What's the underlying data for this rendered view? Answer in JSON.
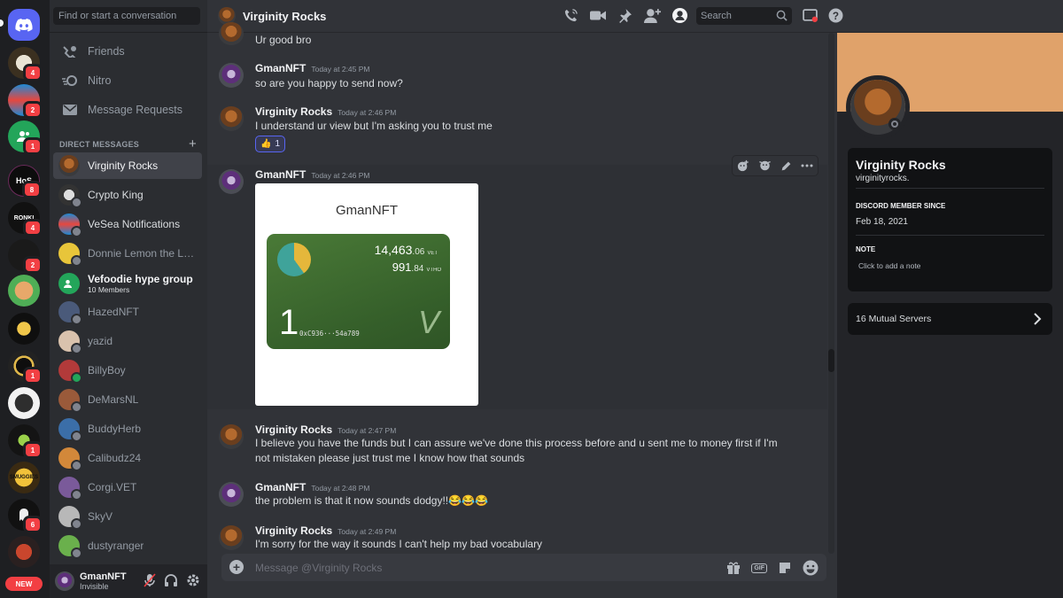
{
  "colors": {
    "accent": "#5865f2",
    "danger": "#f23f43",
    "online": "#23a55a",
    "banner": "#e0a26a"
  },
  "rail": {
    "servers": [
      {
        "name": "discord-home",
        "badge": ""
      },
      {
        "name": "server-1",
        "badge": "4"
      },
      {
        "name": "server-2",
        "badge": "2"
      },
      {
        "name": "server-3",
        "badge": "1"
      },
      {
        "name": "server-hos",
        "label": "HoS",
        "badge": "8"
      },
      {
        "name": "server-ronki",
        "label": "RONKI",
        "badge": "4"
      },
      {
        "name": "server-6",
        "badge": "2"
      },
      {
        "name": "server-7",
        "badge": ""
      },
      {
        "name": "server-8",
        "badge": ""
      },
      {
        "name": "server-9",
        "badge": "1"
      },
      {
        "name": "server-10",
        "badge": ""
      },
      {
        "name": "server-11",
        "badge": "1"
      },
      {
        "name": "server-smuggies",
        "label": "SMUGGIES",
        "badge": ""
      },
      {
        "name": "server-13",
        "badge": "6"
      },
      {
        "name": "server-14",
        "badge": ""
      }
    ],
    "new_label": "NEW"
  },
  "sidebar": {
    "search_placeholder": "Find or start a conversation",
    "nav": [
      "Friends",
      "Nitro",
      "Message Requests"
    ],
    "dm_header": "DIRECT MESSAGES",
    "dms": [
      {
        "name": "Virginity Rocks",
        "active": true
      },
      {
        "name": "Crypto King"
      },
      {
        "name": "VeSea Notifications"
      },
      {
        "name": "Donnie Lemon the Lo..."
      },
      {
        "name": "Vefoodie hype group",
        "sub": "10 Members"
      },
      {
        "name": "HazedNFT"
      },
      {
        "name": "yazid"
      },
      {
        "name": "BillyBoy"
      },
      {
        "name": "DeMarsNL"
      },
      {
        "name": "BuddyHerb"
      },
      {
        "name": "Calibudz24"
      },
      {
        "name": "Corgi.VET"
      },
      {
        "name": "SkyV"
      },
      {
        "name": "dustyranger"
      }
    ],
    "user": {
      "name": "GmanNFT",
      "status": "Invisible"
    }
  },
  "header": {
    "title": "Virginity Rocks",
    "search_placeholder": "Search"
  },
  "messages": [
    {
      "author": "",
      "time": "",
      "text": "Ur good bro"
    },
    {
      "author": "GmanNFT",
      "time": "Today at 2:45 PM",
      "text": "so are you happy to send now?"
    },
    {
      "author": "Virginity Rocks",
      "time": "Today at 2:46 PM",
      "text": "I understand ur view but I'm asking you to trust me",
      "reaction": {
        "emoji": "👍",
        "count": "1"
      }
    },
    {
      "author": "GmanNFT",
      "time": "Today at 2:46 PM",
      "text": ""
    },
    {
      "author": "Virginity Rocks",
      "time": "Today at 2:47 PM",
      "text": "I believe you have the funds but I can assure we've done this process before and u sent me to money first if I'm not mistaken please just trust me I know how that sounds"
    },
    {
      "author": "GmanNFT",
      "time": "Today at 2:48 PM",
      "text": "the problem is that it now sounds dodgy!!😂😂😂"
    },
    {
      "author": "Virginity Rocks",
      "time": "Today at 2:49 PM",
      "text": "I'm sorry for the way it sounds I can't help my bad vocabulary"
    }
  ],
  "wallet_image": {
    "caption": "GmanNFT",
    "vet_main": "14,463",
    "vet_dec": ".06",
    "vet_unit": "VET",
    "vtho_main": "991",
    "vtho_dec": ".84",
    "vtho_unit": "VTHO",
    "index": "1",
    "address": "0xC936···54a789",
    "logo": "V"
  },
  "input": {
    "placeholder": "Message @Virginity Rocks",
    "gif_label": "GIF"
  },
  "profile": {
    "display_name": "Virginity Rocks",
    "username": "virginityrocks.",
    "member_since_label": "DISCORD MEMBER SINCE",
    "member_since": "Feb 18, 2021",
    "note_label": "NOTE",
    "note_placeholder": "Click to add a note",
    "mutual_servers": "16 Mutual Servers"
  }
}
